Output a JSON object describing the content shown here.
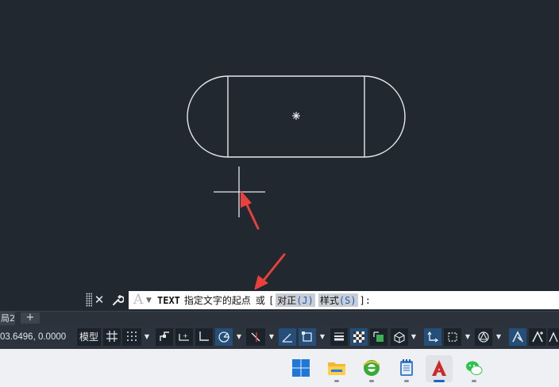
{
  "command_line": {
    "command": "TEXT",
    "prompt": "指定文字的起点",
    "or_text": "或",
    "open_bracket": "[",
    "options": [
      {
        "label": "对正",
        "key": "(J)"
      },
      {
        "label": "样式",
        "key": "(S)"
      }
    ],
    "close_suffix": "]:"
  },
  "layout_tabs": {
    "partial_tab": "局2",
    "add_label": "+"
  },
  "status_bar": {
    "coordinates": "03.6496, 0.0000",
    "model_label": "模型"
  },
  "colors": {
    "canvas_bg": "#212830",
    "drawing_lines": "#e6e8eb",
    "annotation_arrow": "#e8403a",
    "accent_active": "#234f7a"
  },
  "icons": [
    "close-icon",
    "wrench-icon",
    "text-style-icon",
    "grid-icon",
    "snap-icon",
    "ortho-icon",
    "polar-icon",
    "osnap-icon",
    "lineweight-icon",
    "transparency-icon",
    "selection-cycling-icon",
    "3d-osnap-icon",
    "ucs-icon",
    "annotation-icon",
    "windows-start-icon",
    "file-explorer-icon",
    "browser-icon",
    "notepad-icon",
    "autocad-icon",
    "wechat-icon"
  ]
}
